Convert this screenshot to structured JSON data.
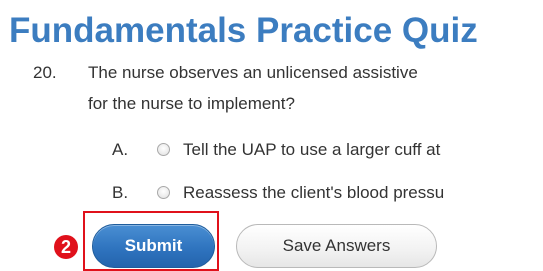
{
  "page": {
    "title": "Fundamentals Practice Quiz"
  },
  "question": {
    "number": "20.",
    "lines": [
      "The nurse observes an unlicensed assistive",
      "for the nurse to implement?"
    ]
  },
  "options": [
    {
      "letter": "A.",
      "text": "Tell the UAP to use a larger cuff at",
      "selected": false
    },
    {
      "letter": "B.",
      "text": "Reassess the client's blood pressu",
      "selected": false
    }
  ],
  "callout": {
    "number": "2",
    "color": "#e0111b"
  },
  "buttons": {
    "submit_label": "Submit",
    "save_label": "Save Answers"
  },
  "colors": {
    "title": "#3c7dc0",
    "submit": "#2f74bf",
    "callout": "#e0111b"
  }
}
